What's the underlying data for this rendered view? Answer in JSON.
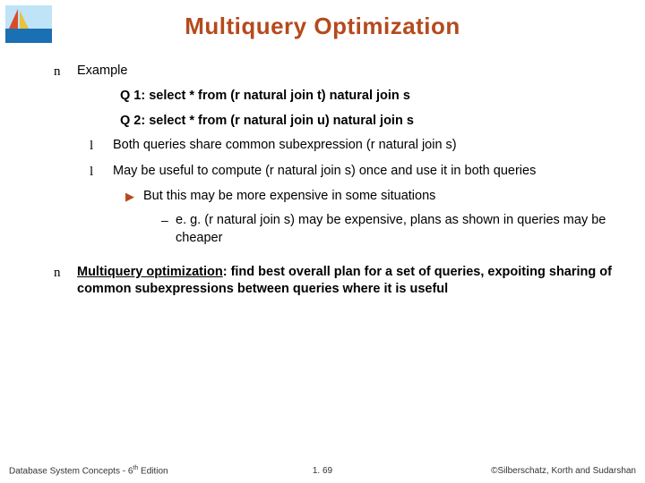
{
  "title": "Multiquery Optimization",
  "body": {
    "example_label": "Example",
    "q1": "Q 1: select * from (r natural join t) natural join s",
    "q2": "Q 2: select * from (r natural join u) natural join s",
    "sub_a": "Both queries share common subexpression (r natural join s)",
    "sub_b": "May be useful to compute (r natural join s) once and use it in both queries",
    "sub_b_1": "But this may be more expensive in some situations",
    "sub_b_1_a": "e. g. (r natural join s) may be expensive, plans as shown in queries may be cheaper",
    "mqo_term": "Multiquery optimization",
    "mqo_rest": ": find best overall plan for a set of queries, expoiting sharing of common subexpressions between queries where it is useful"
  },
  "footer": {
    "left_a": "Database System Concepts - 6",
    "left_sup": "th",
    "left_b": " Edition",
    "center": "1. 69",
    "right": "©Silberschatz, Korth and Sudarshan"
  },
  "bullets": {
    "n": "n",
    "l": "l",
    "arrow": "▶",
    "dash": "–"
  }
}
